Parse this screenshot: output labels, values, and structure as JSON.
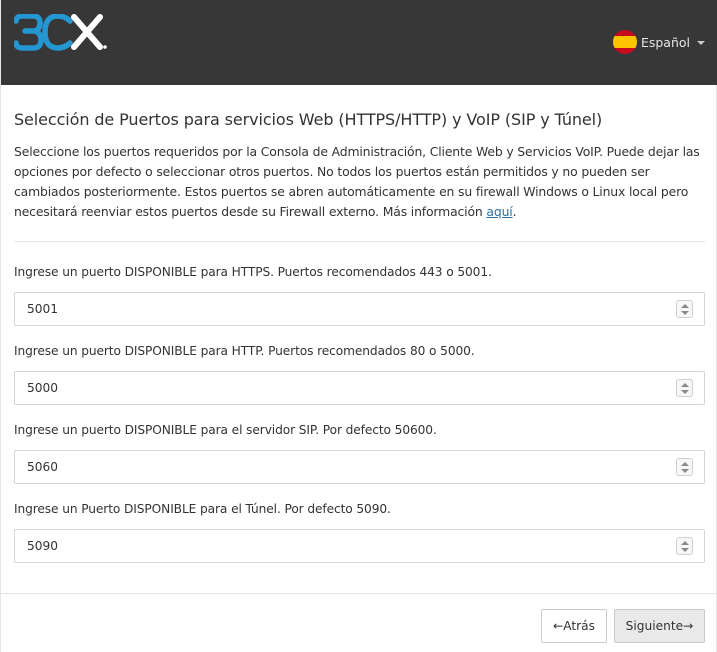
{
  "header": {
    "logo_text": "3CX",
    "language": {
      "label": "Español",
      "icon": "spain-flag-icon"
    },
    "colors": {
      "background": "#373737",
      "logo_blue": "#2496d2",
      "logo_white": "#ffffff"
    }
  },
  "main": {
    "title": "Selección de Puertos para servicios Web (HTTPS/HTTP) y VoIP (SIP y Túnel)",
    "intro_text": "Seleccione los puertos requeridos por la Consola de Administración, Cliente Web y Servicios VoIP. Puede dejar las opciones por defecto o seleccionar otros puertos. No todos los puertos están permitidos y no pueden ser cambiados posteriormente. Estos puertos se abren automáticamente en su firewall Windows o Linux local pero necesitará reenviar estos puertos desde su Firewall externo. Más información ",
    "intro_link": "aquí",
    "intro_end": ".",
    "fields": [
      {
        "label": "Ingrese un puerto DISPONIBLE para HTTPS. Puertos recomendados 443 o 5001.",
        "value": "5001"
      },
      {
        "label": "Ingrese un puerto DISPONIBLE para HTTP. Puertos recomendados 80 o 5000.",
        "value": "5000"
      },
      {
        "label": "Ingrese un puerto DISPONIBLE para el servidor SIP. Por defecto 50600.",
        "value": "5060"
      },
      {
        "label": "Ingrese un Puerto DISPONIBLE para el Túnel. Por defecto 5090.",
        "value": "5090"
      }
    ]
  },
  "footer": {
    "back_label": "←Atrás",
    "next_label": "Siguiente→"
  }
}
